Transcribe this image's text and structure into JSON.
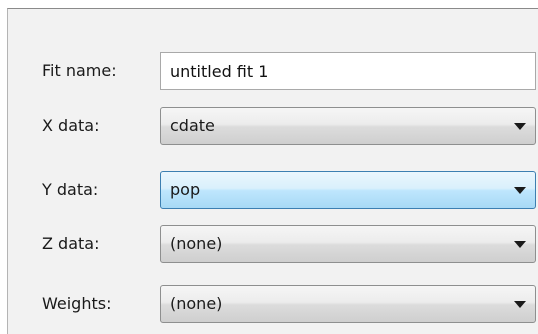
{
  "fit_name": {
    "label": "Fit name:",
    "value": "untitled fit 1"
  },
  "x_data": {
    "label": "X data:",
    "selected": "cdate"
  },
  "y_data": {
    "label": "Y data:",
    "selected": "pop"
  },
  "z_data": {
    "label": "Z data:",
    "selected": "(none)"
  },
  "weights": {
    "label": "Weights:",
    "selected": "(none)"
  },
  "icons": {
    "dropdown_arrow": "chevron-down-icon"
  },
  "colors": {
    "panel_background": "#f2f2f2",
    "focused_dropdown": "#bee6fd",
    "focused_border": "#3c7fb1"
  }
}
